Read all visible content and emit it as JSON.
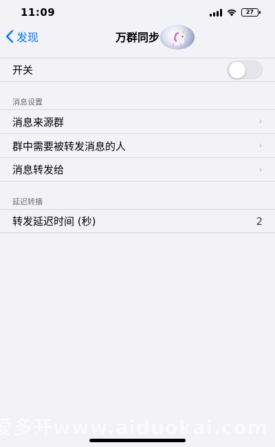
{
  "status_bar": {
    "time": "11:09",
    "battery": "27"
  },
  "nav": {
    "back_label": "发现",
    "title": "万群同步"
  },
  "main_switch": {
    "label": "开关",
    "state": "off"
  },
  "message_settings": {
    "header": "消息设置",
    "items": [
      {
        "label": "消息来源群"
      },
      {
        "label": "群中需要被转发消息的人"
      },
      {
        "label": "消息转发给"
      }
    ]
  },
  "delay_settings": {
    "header": "延迟转播",
    "items": [
      {
        "label": "转发延迟时间 (秒)",
        "value": "2"
      }
    ]
  },
  "watermark": {
    "text": "爱多开www.aiduokai.com"
  },
  "colors": {
    "accent": "#007aff",
    "background": "#f2f2f7"
  }
}
